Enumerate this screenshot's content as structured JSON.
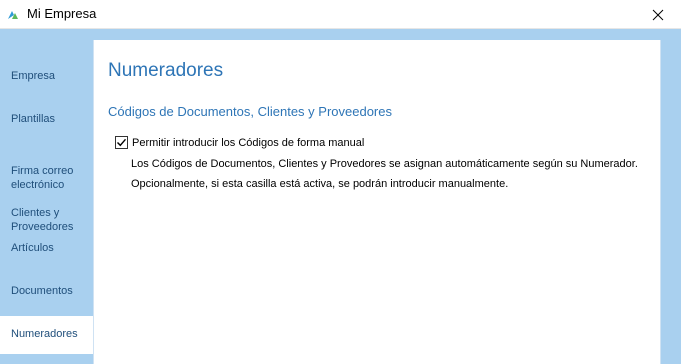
{
  "window": {
    "title": "Mi Empresa",
    "close_glyph": "✕"
  },
  "sidebar": {
    "items": [
      {
        "label": "Empresa"
      },
      {
        "label": "Plantillas"
      },
      {
        "label": "Firma correo\nelectrónico"
      },
      {
        "label": "Clientes y\nProveedores"
      },
      {
        "label": "Artículos"
      },
      {
        "label": "Documentos"
      },
      {
        "label": "Numeradores",
        "active": true
      }
    ]
  },
  "main": {
    "title": "Numeradores",
    "section_title": "Códigos de Documentos, Clientes y Proveedores",
    "checkbox": {
      "label": "Permitir introducir los Códigos de forma manual",
      "checked": true
    },
    "description_line1": "Los Códigos de Documentos, Clientes y Provedores se asignan automáticamente según su Numerador.",
    "description_line2": "Opcionalmente, si esta casilla está activa, se podrán introducir manualmente."
  },
  "colors": {
    "accent": "#2e75b6",
    "sidebar_bg": "#a9d0ef",
    "sidebar_text": "#1f4e7a"
  }
}
